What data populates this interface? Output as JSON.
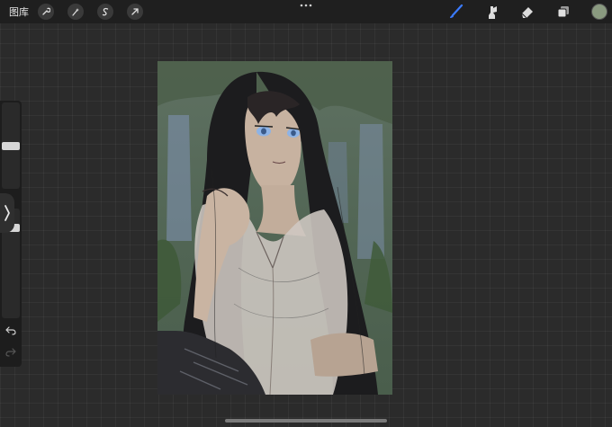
{
  "toolbar": {
    "gallery_label": "图库",
    "left_tools": [
      {
        "icon": "wrench-icon"
      },
      {
        "icon": "magic-wand-icon"
      },
      {
        "icon": "selection-icon"
      },
      {
        "icon": "transform-arrow-icon"
      }
    ],
    "right_tools": [
      {
        "icon": "brush-icon",
        "active": true
      },
      {
        "icon": "smudge-icon"
      },
      {
        "icon": "eraser-icon"
      },
      {
        "icon": "layers-icon"
      }
    ],
    "active_color": "#8a9a80"
  },
  "sidebar": {
    "brush_size_level": 0.5,
    "opacity_level": 0.85
  },
  "colors": {
    "active_tool": "#3b7bff",
    "toolbar_bg": "#1f1f1f",
    "canvas_bg": "#2b2b2b"
  }
}
